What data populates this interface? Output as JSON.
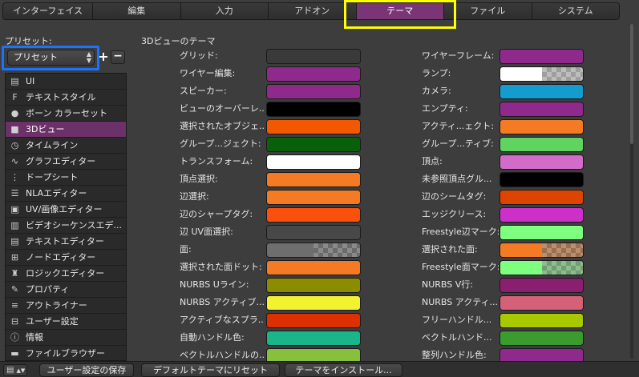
{
  "tabs": [
    {
      "label": "インターフェイス",
      "active": false
    },
    {
      "label": "編集",
      "active": false
    },
    {
      "label": "入力",
      "active": false
    },
    {
      "label": "アドオン",
      "active": false
    },
    {
      "label": "テーマ",
      "active": true
    },
    {
      "label": "ファイル",
      "active": false
    },
    {
      "label": "システム",
      "active": false
    }
  ],
  "preset": {
    "label": "プリセット:",
    "value": "プリセット",
    "add_label": "+",
    "remove_label": "−"
  },
  "sidebar": {
    "items": [
      {
        "label": "UI",
        "icon": "ui-icon",
        "glyph": "▤",
        "active": false
      },
      {
        "label": "テキストスタイル",
        "icon": "text-style-icon",
        "glyph": "F",
        "active": false
      },
      {
        "label": "ボーン カラーセット",
        "icon": "color-wheel-icon",
        "glyph": "●",
        "active": false
      },
      {
        "label": "3Dビュー",
        "icon": "cube-icon",
        "glyph": "■",
        "active": true
      },
      {
        "label": "タイムライン",
        "icon": "clock-icon",
        "glyph": "◷",
        "active": false
      },
      {
        "label": "グラフエディター",
        "icon": "graph-curve-icon",
        "glyph": "∿",
        "active": false
      },
      {
        "label": "ドープシート",
        "icon": "dopesheet-icon",
        "glyph": "⋮",
        "active": false
      },
      {
        "label": "NLAエディター",
        "icon": "nla-icon",
        "glyph": "☰",
        "active": false
      },
      {
        "label": "UV/画像エディター",
        "icon": "image-icon",
        "glyph": "▣",
        "active": false
      },
      {
        "label": "ビデオシーケンスエデ...",
        "icon": "film-strip-icon",
        "glyph": "▥",
        "active": false
      },
      {
        "label": "テキストエディター",
        "icon": "text-document-icon",
        "glyph": "▤",
        "active": false
      },
      {
        "label": "ノードエディター",
        "icon": "node-icon",
        "glyph": "⊞",
        "active": false
      },
      {
        "label": "ロジックエディター",
        "icon": "joystick-icon",
        "glyph": "♜",
        "active": false
      },
      {
        "label": "プロパティ",
        "icon": "wrench-icon",
        "glyph": "✎",
        "active": false
      },
      {
        "label": "アウトライナー",
        "icon": "outliner-icon",
        "glyph": "≡",
        "active": false
      },
      {
        "label": "ユーザー設定",
        "icon": "preferences-icon",
        "glyph": "⊟",
        "active": false
      },
      {
        "label": "情報",
        "icon": "info-icon",
        "glyph": "ⓘ",
        "active": false
      },
      {
        "label": "ファイルブラウザー",
        "icon": "folder-icon",
        "glyph": "▬",
        "active": false
      }
    ]
  },
  "section_title": "3Dビューのテーマ",
  "left_colors": [
    {
      "label": "グリッド:",
      "color": "#3a3a3a"
    },
    {
      "label": "ワイヤー編集:",
      "color": "#8f2a8c"
    },
    {
      "label": "スピーカー:",
      "color": "#8f2a8c"
    },
    {
      "label": "ビューのオーバーレ...",
      "color": "#000000"
    },
    {
      "label": "選択されたオブジェ...",
      "color": "#f15800"
    },
    {
      "label": "グループ...ジェクト:",
      "color": "#0a5f0a"
    },
    {
      "label": "トランスフォーム:",
      "color": "#ffffff"
    },
    {
      "label": "頂点選択:",
      "color": "#f47b23"
    },
    {
      "label": "辺選択:",
      "color": "#f47b23"
    },
    {
      "label": "辺のシャープタグ:",
      "color": "#fb4f0c"
    },
    {
      "label": "辺 UV面選択:",
      "color": "#484848"
    },
    {
      "label": "面:",
      "color": "#6e6e6e",
      "alpha": true
    },
    {
      "label": "選択された面ドット:",
      "color": "#f47b23"
    },
    {
      "label": "NURBS Uライン:",
      "color": "#8c8c00"
    },
    {
      "label": "NURBS アクティブ...",
      "color": "#f2f230"
    },
    {
      "label": "アクティブなスプラ...",
      "color": "#dc3000"
    },
    {
      "label": "自動ハンドル色:",
      "color": "#1ab588"
    },
    {
      "label": "ベクトルハンドルの...",
      "color": "#86c03c"
    }
  ],
  "right_colors": [
    {
      "label": "ワイヤーフレーム:",
      "color": "#8f2a8c"
    },
    {
      "label": "ランプ:",
      "color": "#ffffff",
      "alpha": true
    },
    {
      "label": "カメラ:",
      "color": "#159cce"
    },
    {
      "label": "エンプティ:",
      "color": "#8f2a8c"
    },
    {
      "label": "アクティ...ェクト:",
      "color": "#f47b23"
    },
    {
      "label": "グループ...ティブ:",
      "color": "#5fd45f"
    },
    {
      "label": "頂点:",
      "color": "#d26cc8"
    },
    {
      "label": "未参照頂点グル...",
      "color": "#000000"
    },
    {
      "label": "辺のシームタグ:",
      "color": "#dd4400"
    },
    {
      "label": "エッジクリース:",
      "color": "#cc30c8"
    },
    {
      "label": "Freestyle辺マーク:",
      "color": "#7fff7f"
    },
    {
      "label": "選択された面:",
      "color": "#f47b23",
      "alpha": true
    },
    {
      "label": "Freestyle面マーク:",
      "color": "#7fff7f",
      "alpha": true
    },
    {
      "label": "NURBS V行:",
      "color": "#8a1f70"
    },
    {
      "label": "NURBS アクティ...",
      "color": "#d46079"
    },
    {
      "label": "フリーハンドル...",
      "color": "#a8c800"
    },
    {
      "label": "ベクトルハンド...",
      "color": "#3a9c2c"
    },
    {
      "label": "整列ハンドル色:",
      "color": "#8f2a8c"
    }
  ],
  "bottom": {
    "editor_icon": "preferences-icon",
    "buttons": [
      {
        "label": "ユーザー設定の保存"
      },
      {
        "label": "デフォルトテーマにリセット"
      },
      {
        "label": "テーマをインストール..."
      }
    ]
  }
}
